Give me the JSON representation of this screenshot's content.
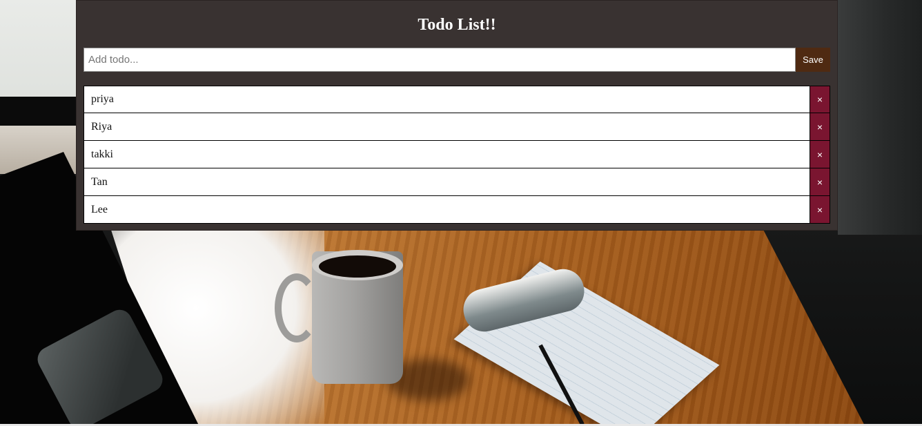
{
  "app": {
    "title": "Todo List!!"
  },
  "add_todo": {
    "placeholder": "Add todo...",
    "value": "",
    "save_label": "Save"
  },
  "todos": [
    {
      "text": "priya",
      "delete_label": "×"
    },
    {
      "text": "Riya",
      "delete_label": "×"
    },
    {
      "text": "takki",
      "delete_label": "×"
    },
    {
      "text": "Tan",
      "delete_label": "×"
    },
    {
      "text": "Lee",
      "delete_label": "×"
    }
  ],
  "colors": {
    "panel_background": "#393231",
    "save_button": "#4f2a12",
    "delete_button": "#7a1530",
    "title_text": "#ffffff"
  },
  "background": {
    "image_subject": "photo"
  }
}
